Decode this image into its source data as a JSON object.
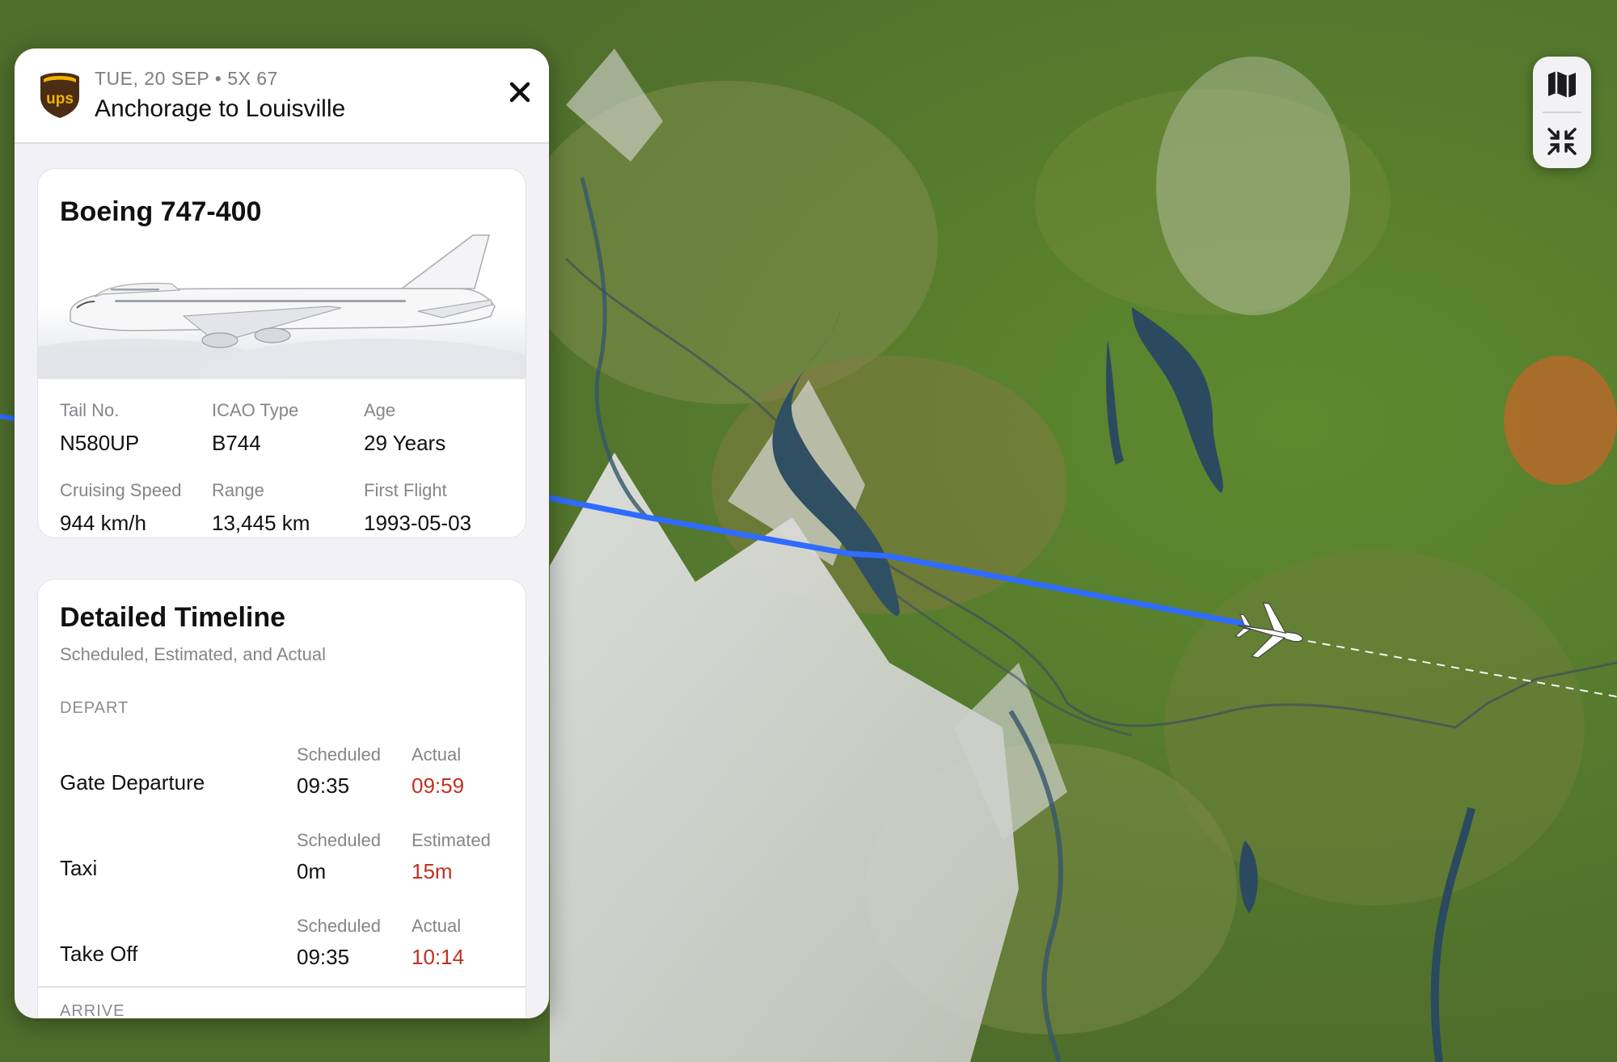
{
  "header": {
    "airline_logo": "ups",
    "date_flight": "TUE, 20 SEP • 5X 67",
    "route_title": "Anchorage to Louisville",
    "close_icon": "close-icon"
  },
  "aircraft": {
    "model": "Boeing 747-400",
    "specs": [
      {
        "label": "Tail No.",
        "value": "N580UP"
      },
      {
        "label": "ICAO Type",
        "value": "B744"
      },
      {
        "label": "Age",
        "value": "29 Years"
      },
      {
        "label": "Cruising Speed",
        "value": "944 km/h"
      },
      {
        "label": "Range",
        "value": "13,445 km"
      },
      {
        "label": "First Flight",
        "value": "1993-05-03"
      }
    ]
  },
  "timeline": {
    "title": "Detailed Timeline",
    "subtitle": "Scheduled, Estimated, and Actual",
    "section_depart": "DEPART",
    "rows": [
      {
        "name": "Gate Departure",
        "col1_label": "Scheduled",
        "col1_value": "09:35",
        "col2_label": "Actual",
        "col2_value": "09:59"
      },
      {
        "name": "Taxi",
        "col1_label": "Scheduled",
        "col1_value": "0m",
        "col2_label": "Estimated",
        "col2_value": "15m"
      },
      {
        "name": "Take Off",
        "col1_label": "Scheduled",
        "col1_value": "09:35",
        "col2_label": "Actual",
        "col2_value": "10:14"
      }
    ],
    "section_arrive": "ARRIVE"
  },
  "map_controls": {
    "map_mode_icon": "map-icon",
    "collapse_icon": "collapse-icon"
  },
  "colors": {
    "flight_path": "#2f6bff",
    "delay_red": "#c0311f",
    "ups_brown": "#4a2d13",
    "ups_gold": "#f4b400"
  }
}
